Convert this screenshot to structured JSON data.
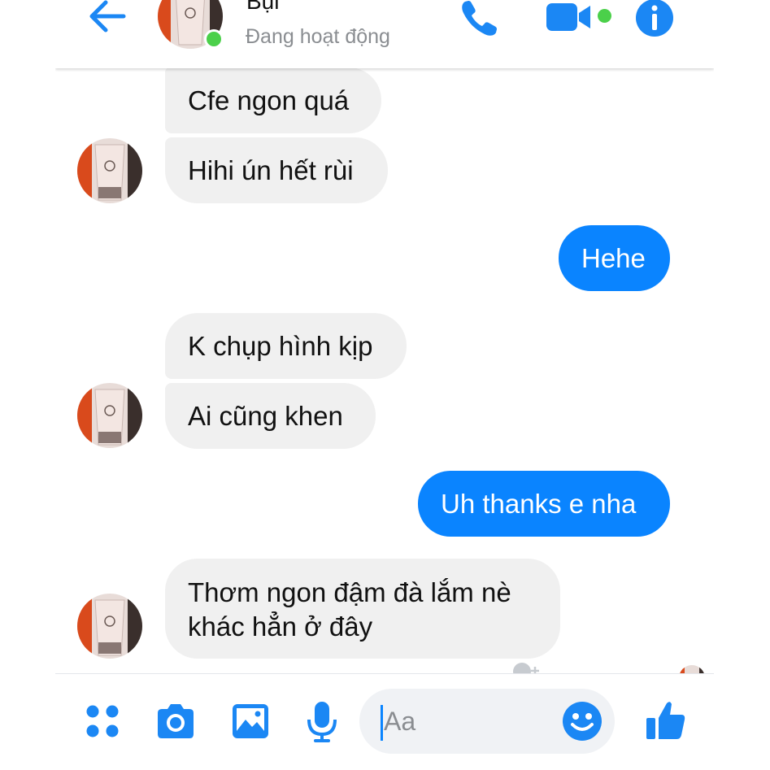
{
  "header": {
    "contact_name": "Bụi",
    "status": "Đang hoạt động"
  },
  "messages": [
    {
      "side": "incoming",
      "text_lines": [
        "Cfe ngon quá"
      ]
    },
    {
      "side": "incoming",
      "text_lines": [
        "Hihi ún hết rùi"
      ]
    },
    {
      "side": "outgoing",
      "text_lines": [
        "Hehe"
      ]
    },
    {
      "side": "incoming",
      "text_lines": [
        "K chụp hình kịp"
      ]
    },
    {
      "side": "incoming",
      "text_lines": [
        "Ai cũng khen"
      ]
    },
    {
      "side": "outgoing",
      "text_lines": [
        "Uh thanks e nha"
      ]
    },
    {
      "side": "incoming",
      "text_lines": [
        "Thơm ngon đậm đà lắm nè",
        "khác hẳn ở đây"
      ]
    }
  ],
  "composer": {
    "placeholder": "Aa"
  },
  "colors": {
    "accent": "#0a84ff",
    "icon_blue": "#1b87f4",
    "online_green": "#4bd04a",
    "incoming_bubble": "#f0f0f0"
  },
  "icons": [
    "back-arrow-icon",
    "phone-icon",
    "video-camera-icon",
    "info-icon",
    "apps-grid-icon",
    "camera-icon",
    "image-icon",
    "microphone-icon",
    "emoji-icon",
    "thumbs-up-icon"
  ]
}
